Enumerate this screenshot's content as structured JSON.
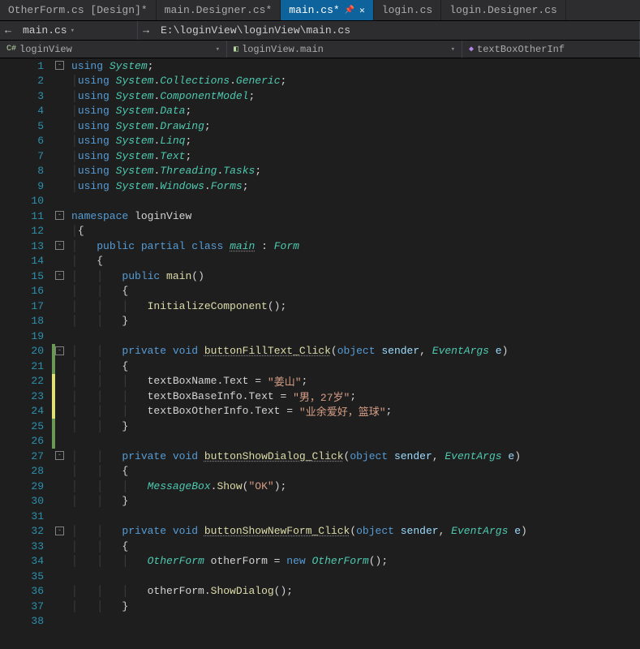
{
  "tabs": [
    {
      "label": "OtherForm.cs [Design]*",
      "active": false
    },
    {
      "label": "main.Designer.cs*",
      "active": false
    },
    {
      "label": "main.cs*",
      "active": true,
      "pinned": true,
      "closable": true
    },
    {
      "label": "login.cs",
      "active": false
    },
    {
      "label": "login.Designer.cs",
      "active": false
    }
  ],
  "nav": {
    "back": "←",
    "file": "main.cs",
    "filepath": "E:\\loginView\\loginView\\main.cs"
  },
  "crumbs": {
    "ns": "loginView",
    "class": "loginView.main",
    "member": "textBoxOtherInf"
  },
  "code": [
    {
      "n": 1,
      "fold": "-",
      "tokens": [
        [
          "kw",
          "using"
        ],
        [
          "punct",
          " "
        ],
        [
          "type",
          "System"
        ],
        [
          "punct",
          ";"
        ]
      ]
    },
    {
      "n": 2,
      "tokens": [
        [
          "guide",
          "│"
        ],
        [
          "kw",
          "using"
        ],
        [
          "punct",
          " "
        ],
        [
          "type",
          "System"
        ],
        [
          "punct",
          "."
        ],
        [
          "type",
          "Collections"
        ],
        [
          "punct",
          "."
        ],
        [
          "type",
          "Generic"
        ],
        [
          "punct",
          ";"
        ]
      ]
    },
    {
      "n": 3,
      "tokens": [
        [
          "guide",
          "│"
        ],
        [
          "kw",
          "using"
        ],
        [
          "punct",
          " "
        ],
        [
          "type",
          "System"
        ],
        [
          "punct",
          "."
        ],
        [
          "type",
          "ComponentModel"
        ],
        [
          "punct",
          ";"
        ]
      ]
    },
    {
      "n": 4,
      "tokens": [
        [
          "guide",
          "│"
        ],
        [
          "kw",
          "using"
        ],
        [
          "punct",
          " "
        ],
        [
          "type",
          "System"
        ],
        [
          "punct",
          "."
        ],
        [
          "type",
          "Data"
        ],
        [
          "punct",
          ";"
        ]
      ]
    },
    {
      "n": 5,
      "tokens": [
        [
          "guide",
          "│"
        ],
        [
          "kw",
          "using"
        ],
        [
          "punct",
          " "
        ],
        [
          "type",
          "System"
        ],
        [
          "punct",
          "."
        ],
        [
          "type",
          "Drawing"
        ],
        [
          "punct",
          ";"
        ]
      ]
    },
    {
      "n": 6,
      "tokens": [
        [
          "guide",
          "│"
        ],
        [
          "kw",
          "using"
        ],
        [
          "punct",
          " "
        ],
        [
          "type",
          "System"
        ],
        [
          "punct",
          "."
        ],
        [
          "type",
          "Linq"
        ],
        [
          "punct",
          ";"
        ]
      ]
    },
    {
      "n": 7,
      "tokens": [
        [
          "guide",
          "│"
        ],
        [
          "kw",
          "using"
        ],
        [
          "punct",
          " "
        ],
        [
          "type",
          "System"
        ],
        [
          "punct",
          "."
        ],
        [
          "type",
          "Text"
        ],
        [
          "punct",
          ";"
        ]
      ]
    },
    {
      "n": 8,
      "tokens": [
        [
          "guide",
          "│"
        ],
        [
          "kw",
          "using"
        ],
        [
          "punct",
          " "
        ],
        [
          "type",
          "System"
        ],
        [
          "punct",
          "."
        ],
        [
          "type",
          "Threading"
        ],
        [
          "punct",
          "."
        ],
        [
          "type",
          "Tasks"
        ],
        [
          "punct",
          ";"
        ]
      ]
    },
    {
      "n": 9,
      "tokens": [
        [
          "guide",
          "│"
        ],
        [
          "kw",
          "using"
        ],
        [
          "punct",
          " "
        ],
        [
          "type",
          "System"
        ],
        [
          "punct",
          "."
        ],
        [
          "type",
          "Windows"
        ],
        [
          "punct",
          "."
        ],
        [
          "type",
          "Forms"
        ],
        [
          "punct",
          ";"
        ]
      ]
    },
    {
      "n": 10,
      "tokens": []
    },
    {
      "n": 11,
      "fold": "-",
      "tokens": [
        [
          "kw",
          "namespace"
        ],
        [
          "punct",
          " "
        ],
        [
          "ident",
          "loginView"
        ]
      ]
    },
    {
      "n": 12,
      "tokens": [
        [
          "guide",
          "│"
        ],
        [
          "punct",
          "{"
        ]
      ]
    },
    {
      "n": 13,
      "fold": "-",
      "tokens": [
        [
          "guide",
          "│   "
        ],
        [
          "kw",
          "public"
        ],
        [
          "punct",
          " "
        ],
        [
          "kw",
          "partial"
        ],
        [
          "punct",
          " "
        ],
        [
          "kw",
          "class"
        ],
        [
          "punct",
          " "
        ],
        [
          "type dot-under",
          "main"
        ],
        [
          "punct",
          " : "
        ],
        [
          "type",
          "Form"
        ]
      ]
    },
    {
      "n": 14,
      "tokens": [
        [
          "guide",
          "│   "
        ],
        [
          "punct",
          "{"
        ]
      ]
    },
    {
      "n": 15,
      "fold": "-",
      "tokens": [
        [
          "guide",
          "│   │   "
        ],
        [
          "kw",
          "public"
        ],
        [
          "punct",
          " "
        ],
        [
          "method-def",
          "main"
        ],
        [
          "punct",
          "()"
        ]
      ]
    },
    {
      "n": 16,
      "tokens": [
        [
          "guide",
          "│   │   "
        ],
        [
          "punct",
          "{"
        ]
      ]
    },
    {
      "n": 17,
      "tokens": [
        [
          "guide",
          "│   │   │   "
        ],
        [
          "method",
          "InitializeComponent"
        ],
        [
          "punct",
          "();"
        ]
      ]
    },
    {
      "n": 18,
      "tokens": [
        [
          "guide",
          "│   │   "
        ],
        [
          "punct",
          "}"
        ]
      ]
    },
    {
      "n": 19,
      "tokens": []
    },
    {
      "n": 20,
      "fold": "-",
      "cb": "green",
      "tokens": [
        [
          "guide",
          "│   │   "
        ],
        [
          "kw",
          "private"
        ],
        [
          "punct",
          " "
        ],
        [
          "kw",
          "void"
        ],
        [
          "punct",
          " "
        ],
        [
          "method-def dot-under",
          "buttonFillText_Click"
        ],
        [
          "punct",
          "("
        ],
        [
          "kw",
          "object"
        ],
        [
          "punct",
          " "
        ],
        [
          "param",
          "sender"
        ],
        [
          "punct",
          ", "
        ],
        [
          "type",
          "EventArgs"
        ],
        [
          "punct",
          " "
        ],
        [
          "param",
          "e"
        ],
        [
          "punct",
          ")"
        ]
      ]
    },
    {
      "n": 21,
      "cb": "green",
      "tokens": [
        [
          "guide",
          "│   │   "
        ],
        [
          "punct",
          "{"
        ]
      ]
    },
    {
      "n": 22,
      "cb": "yellow",
      "tokens": [
        [
          "guide",
          "│   │   │   "
        ],
        [
          "ident",
          "textBoxName"
        ],
        [
          "punct",
          "."
        ],
        [
          "ident",
          "Text"
        ],
        [
          "punct",
          " = "
        ],
        [
          "str",
          "\"姜山\""
        ],
        [
          "punct",
          ";"
        ]
      ]
    },
    {
      "n": 23,
      "cb": "yellow",
      "tokens": [
        [
          "guide",
          "│   │   │   "
        ],
        [
          "ident",
          "textBoxBaseInfo"
        ],
        [
          "punct",
          "."
        ],
        [
          "ident",
          "Text"
        ],
        [
          "punct",
          " = "
        ],
        [
          "str",
          "\"男，27岁\""
        ],
        [
          "punct",
          ";"
        ]
      ]
    },
    {
      "n": 24,
      "cb": "yellow",
      "tokens": [
        [
          "guide",
          "│   │   │   "
        ],
        [
          "ident",
          "textBoxOtherInfo"
        ],
        [
          "punct",
          "."
        ],
        [
          "ident",
          "Text"
        ],
        [
          "punct",
          " = "
        ],
        [
          "str",
          "\"业余爱好，篮球\""
        ],
        [
          "punct",
          ";"
        ]
      ]
    },
    {
      "n": 25,
      "cb": "green",
      "tokens": [
        [
          "guide",
          "│   │   "
        ],
        [
          "punct",
          "}"
        ]
      ]
    },
    {
      "n": 26,
      "cb": "green",
      "tokens": []
    },
    {
      "n": 27,
      "fold": "-",
      "tokens": [
        [
          "guide",
          "│   │   "
        ],
        [
          "kw",
          "private"
        ],
        [
          "punct",
          " "
        ],
        [
          "kw",
          "void"
        ],
        [
          "punct",
          " "
        ],
        [
          "method-def dot-under",
          "buttonShowDialog_Click"
        ],
        [
          "punct",
          "("
        ],
        [
          "kw",
          "object"
        ],
        [
          "punct",
          " "
        ],
        [
          "param",
          "sender"
        ],
        [
          "punct",
          ", "
        ],
        [
          "type",
          "EventArgs"
        ],
        [
          "punct",
          " "
        ],
        [
          "param",
          "e"
        ],
        [
          "punct",
          ")"
        ]
      ]
    },
    {
      "n": 28,
      "tokens": [
        [
          "guide",
          "│   │   "
        ],
        [
          "punct",
          "{"
        ]
      ]
    },
    {
      "n": 29,
      "tokens": [
        [
          "guide",
          "│   │   │   "
        ],
        [
          "type",
          "MessageBox"
        ],
        [
          "punct",
          "."
        ],
        [
          "method",
          "Show"
        ],
        [
          "punct",
          "("
        ],
        [
          "str",
          "\"OK\""
        ],
        [
          "punct",
          ");"
        ]
      ]
    },
    {
      "n": 30,
      "tokens": [
        [
          "guide",
          "│   │   "
        ],
        [
          "punct",
          "}"
        ]
      ]
    },
    {
      "n": 31,
      "tokens": []
    },
    {
      "n": 32,
      "fold": "-",
      "tokens": [
        [
          "guide",
          "│   │   "
        ],
        [
          "kw",
          "private"
        ],
        [
          "punct",
          " "
        ],
        [
          "kw",
          "void"
        ],
        [
          "punct",
          " "
        ],
        [
          "method-def dot-under",
          "buttonShowNewForm_Click"
        ],
        [
          "punct",
          "("
        ],
        [
          "kw",
          "object"
        ],
        [
          "punct",
          " "
        ],
        [
          "param",
          "sender"
        ],
        [
          "punct",
          ", "
        ],
        [
          "type",
          "EventArgs"
        ],
        [
          "punct",
          " "
        ],
        [
          "param",
          "e"
        ],
        [
          "punct",
          ")"
        ]
      ]
    },
    {
      "n": 33,
      "tokens": [
        [
          "guide",
          "│   │   "
        ],
        [
          "punct",
          "{"
        ]
      ]
    },
    {
      "n": 34,
      "tokens": [
        [
          "guide",
          "│   │   │   "
        ],
        [
          "type",
          "OtherForm"
        ],
        [
          "punct",
          " "
        ],
        [
          "ident",
          "otherForm"
        ],
        [
          "punct",
          " = "
        ],
        [
          "kw",
          "new"
        ],
        [
          "punct",
          " "
        ],
        [
          "type",
          "OtherForm"
        ],
        [
          "punct",
          "();"
        ]
      ]
    },
    {
      "n": 35,
      "tokens": []
    },
    {
      "n": 36,
      "tokens": [
        [
          "guide",
          "│   │   │   "
        ],
        [
          "ident",
          "otherForm"
        ],
        [
          "punct",
          "."
        ],
        [
          "method",
          "ShowDialog"
        ],
        [
          "punct",
          "();"
        ]
      ]
    },
    {
      "n": 37,
      "tokens": [
        [
          "guide",
          "│   │   "
        ],
        [
          "punct",
          "}"
        ]
      ]
    },
    {
      "n": 38,
      "tokens": []
    }
  ]
}
